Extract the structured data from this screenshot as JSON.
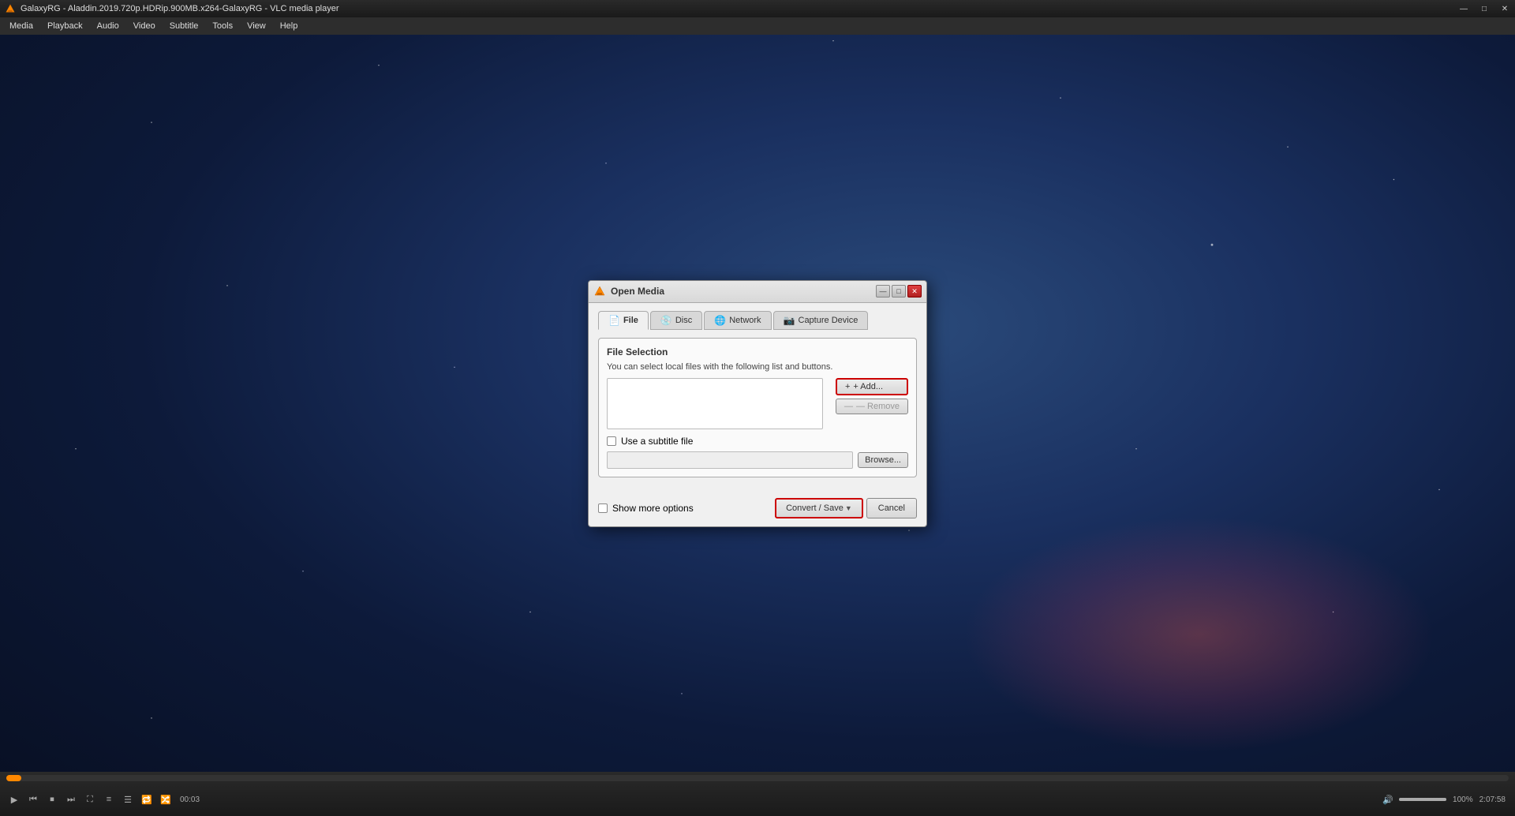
{
  "titlebar": {
    "title": "GalaxyRG - Aladdin.2019.720p.HDRip.900MB.x264-GalaxyRG - VLC media player",
    "minimize_label": "—",
    "maximize_label": "□",
    "close_label": "✕"
  },
  "menubar": {
    "items": [
      "Media",
      "Playback",
      "Audio",
      "Video",
      "Subtitle",
      "Tools",
      "View",
      "Help"
    ]
  },
  "dialog": {
    "title": "Open Media",
    "title_icon": "🔶",
    "tabs": [
      {
        "id": "file",
        "label": "File",
        "icon": "📄",
        "active": true
      },
      {
        "id": "disc",
        "label": "Disc",
        "icon": "💿",
        "active": false
      },
      {
        "id": "network",
        "label": "Network",
        "icon": "🌐",
        "active": false
      },
      {
        "id": "capture",
        "label": "Capture Device",
        "icon": "📷",
        "active": false
      }
    ],
    "file_selection": {
      "section_title": "File Selection",
      "description": "You can select local files with the following list and buttons.",
      "add_button": "+ Add...",
      "remove_button": "— Remove",
      "subtitle_checkbox_label": "Use a subtitle file",
      "subtitle_placeholder": "",
      "browse_button": "Browse...",
      "show_more_label": "Show more options"
    },
    "footer": {
      "convert_save_label": "Convert / Save",
      "cancel_label": "Cancel"
    }
  },
  "bottombar": {
    "time_current": "00:03",
    "time_total": "2:07:58",
    "volume_percent": "100%"
  }
}
